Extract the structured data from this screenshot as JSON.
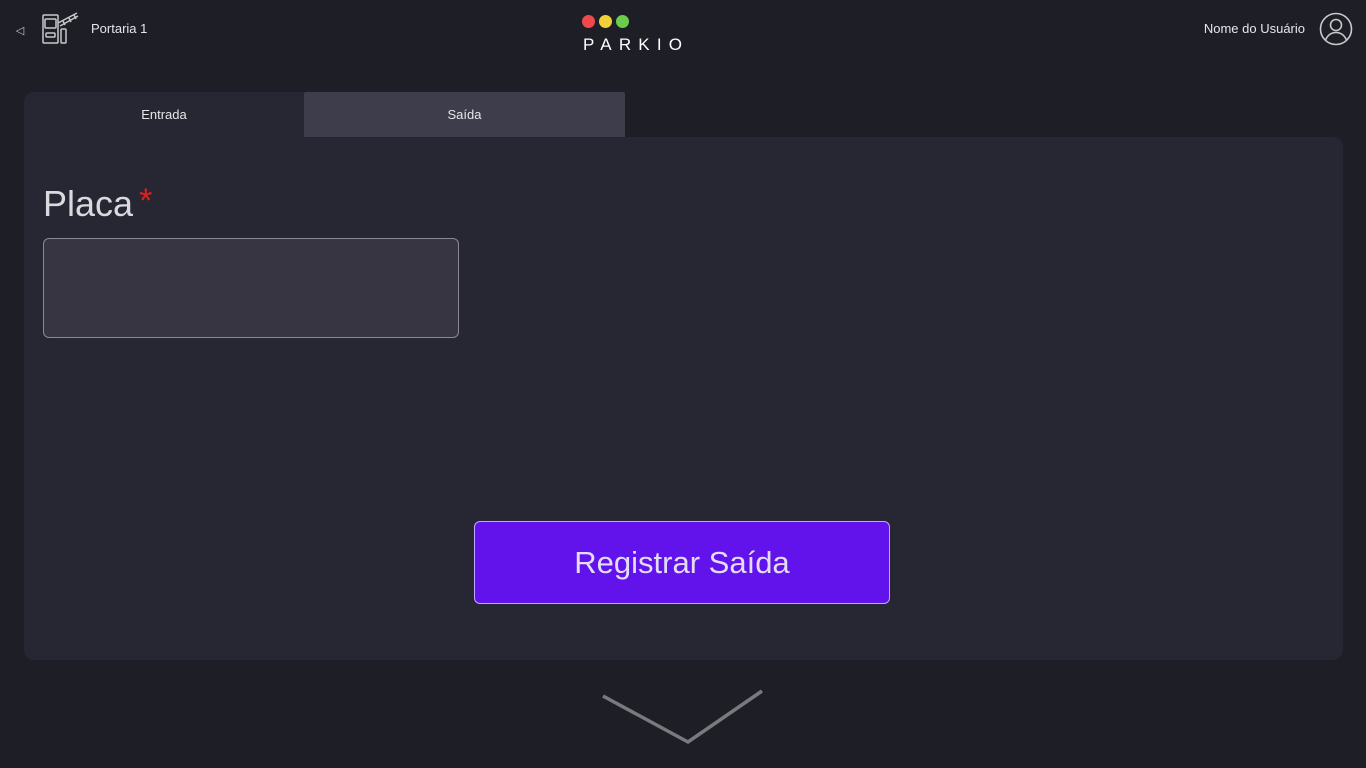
{
  "header": {
    "back_icon": "triangle-left-icon",
    "gate_icon": "gate-barrier-icon",
    "gate_name": "Portaria 1",
    "logo_text": "PARKIO",
    "logo_dot_colors": [
      "#f0484c",
      "#f2d03c",
      "#6ccc4c"
    ],
    "user_name": "Nome do Usuário",
    "user_icon": "user-circle-icon"
  },
  "tabs": [
    {
      "label": "Entrada",
      "active": true
    },
    {
      "label": "Saída",
      "active": false
    }
  ],
  "form": {
    "placa_label": "Placa",
    "required_mark": "*",
    "placa_value": "",
    "submit_label": "Registrar Saída"
  },
  "footer": {
    "scroll_icon": "chevron-down-icon"
  },
  "colors": {
    "background": "#1e1f26",
    "panel": "#262732",
    "accent": "#6213ec",
    "required": "#e02020"
  }
}
